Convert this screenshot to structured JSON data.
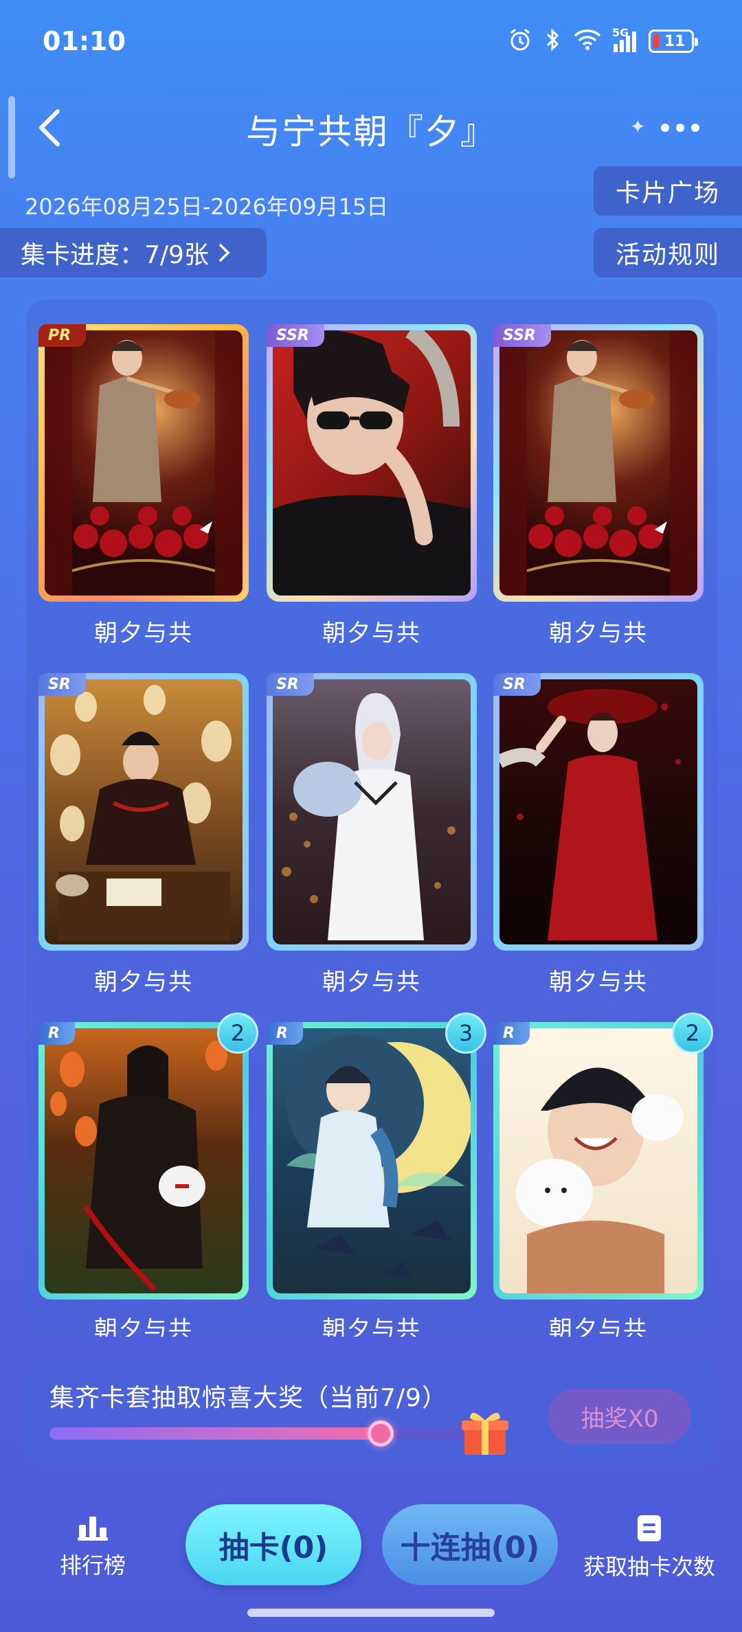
{
  "status_bar": {
    "time": "01:10",
    "network": "5G",
    "battery": "11"
  },
  "header": {
    "title": "与宁共朝『夕』"
  },
  "date_range": "2026年08月25日-2026年09月15日",
  "side_buttons": {
    "plaza": "卡片广场",
    "rules": "活动规则"
  },
  "progress": {
    "label": "集卡进度：7/9张",
    "collected": 7,
    "total": 9
  },
  "cards": [
    {
      "rarity": "PR",
      "name": "朝夕与共",
      "count": ""
    },
    {
      "rarity": "SSR",
      "name": "朝夕与共",
      "count": ""
    },
    {
      "rarity": "SSR",
      "name": "朝夕与共",
      "count": ""
    },
    {
      "rarity": "SR",
      "name": "朝夕与共",
      "count": ""
    },
    {
      "rarity": "SR",
      "name": "朝夕与共",
      "count": ""
    },
    {
      "rarity": "SR",
      "name": "朝夕与共",
      "count": ""
    },
    {
      "rarity": "R",
      "name": "朝夕与共",
      "count": "2"
    },
    {
      "rarity": "R",
      "name": "朝夕与共",
      "count": "3"
    },
    {
      "rarity": "R",
      "name": "朝夕与共",
      "count": "2"
    }
  ],
  "reward": {
    "text": "集齐卡套抽取惊喜大奖（当前7/9）",
    "progress_fraction": 0.7778,
    "button_label": "抽奖X0"
  },
  "bottom": {
    "rank_label": "排行榜",
    "draw_label": "抽卡(0)",
    "ten_draw_label": "十连抽(0)",
    "get_draws_label": "获取抽卡次数"
  }
}
